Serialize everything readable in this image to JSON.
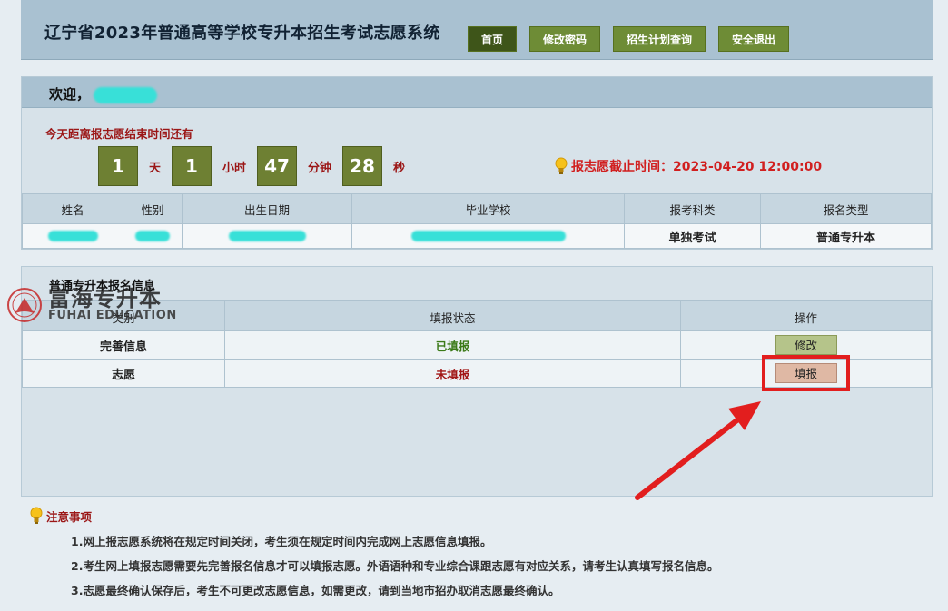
{
  "header": {
    "title": "辽宁省2023年普通高等学校专升本招生考试志愿系统",
    "nav": [
      "首页",
      "修改密码",
      "招生计划查询",
      "安全退出"
    ]
  },
  "welcome": {
    "label": "欢迎，",
    "countdown_label": "今天距离报志愿结束时间还有",
    "countdown": [
      {
        "value": "1",
        "unit": "天"
      },
      {
        "value": "1",
        "unit": "小时"
      },
      {
        "value": "47",
        "unit": "分钟"
      },
      {
        "value": "28",
        "unit": "秒"
      }
    ],
    "deadline": "报志愿截止时间：2023-04-20 12:00:00"
  },
  "info_table": {
    "headers": [
      "姓名",
      "性别",
      "出生日期",
      "毕业学校",
      "报考科类",
      "报名类型"
    ],
    "row": {
      "subject": "单独考试",
      "type": "普通专升本"
    }
  },
  "registration": {
    "title": "普通专升本报名信息",
    "headers": [
      "类别",
      "填报状态",
      "操作"
    ],
    "rows": [
      {
        "category": "完善信息",
        "status": "已填报",
        "action": "修改"
      },
      {
        "category": "志愿",
        "status": "未填报",
        "action": "填报"
      }
    ]
  },
  "watermark": {
    "cn": "富海专升本",
    "en": "FUHAI EDUCATION"
  },
  "notes": {
    "title": "注意事项",
    "items": [
      "1.网上报志愿系统将在规定时间关闭，考生须在规定时间内完成网上志愿信息填报。",
      "2.考生网上填报志愿需要先完善报名信息才可以填报志愿。外语语种和专业综合课跟志愿有对应关系，请考生认真填写报名信息。",
      "3.志愿最终确认保存后，考生不可更改志愿信息，如需更改，请到当地市招办取消志愿最终确认。"
    ]
  },
  "colors": {
    "accent": "#6e8c36",
    "highlight": "#e21e1e",
    "warning_text": "#d11f1f"
  }
}
